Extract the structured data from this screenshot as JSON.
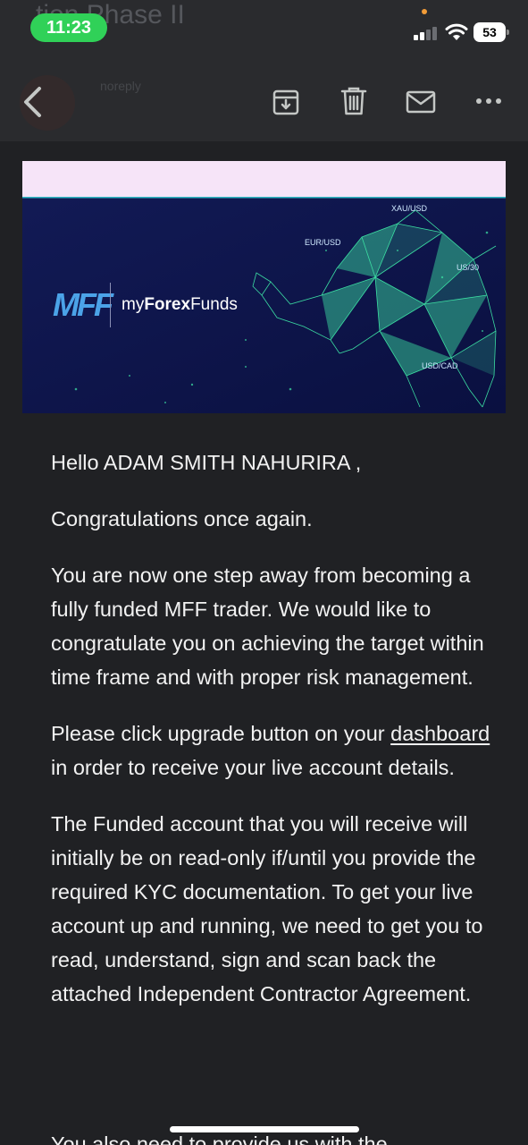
{
  "status_bar": {
    "time": "11:23",
    "battery": "53"
  },
  "background": {
    "subject_partial": "tion Phase II",
    "sender_partial": "noreply"
  },
  "toolbar": {
    "back": "back",
    "archive": "archive",
    "delete": "delete",
    "mark_unread": "mark unread",
    "more": "more"
  },
  "banner": {
    "brand": "myForexFunds",
    "brand_prefix": "my",
    "brand_main": "Forex",
    "brand_suffix": "Funds",
    "logo_mark": "MFF",
    "pairs": [
      "XAU/USD",
      "EUR/USD",
      "US/30",
      "USD/CAD"
    ]
  },
  "email": {
    "greeting": "Hello ADAM SMITH NAHURIRA ,",
    "congrats": "Congratulations once again.",
    "para1": "You are now one step away from becoming a fully funded MFF trader. We would like to congratulate you on achieving the target within time frame and with proper risk management.",
    "para2_before": "Please click upgrade button on your ",
    "para2_link": "dashboard",
    "para2_after": " in order to receive your live account details.",
    "para3": "The Funded account that you will receive will initially be on read-only if/until you provide the required KYC documentation. To get your live account up and running, we need to get you to read, understand, sign and scan back the attached Independent Contractor Agreement.",
    "para4_partial": "You also need to provide us with the"
  },
  "colors": {
    "accent_green": "#30d158",
    "banner_bg": "#0f1647",
    "bull": "#3ee6a6",
    "strip": "#f6e4f8"
  }
}
